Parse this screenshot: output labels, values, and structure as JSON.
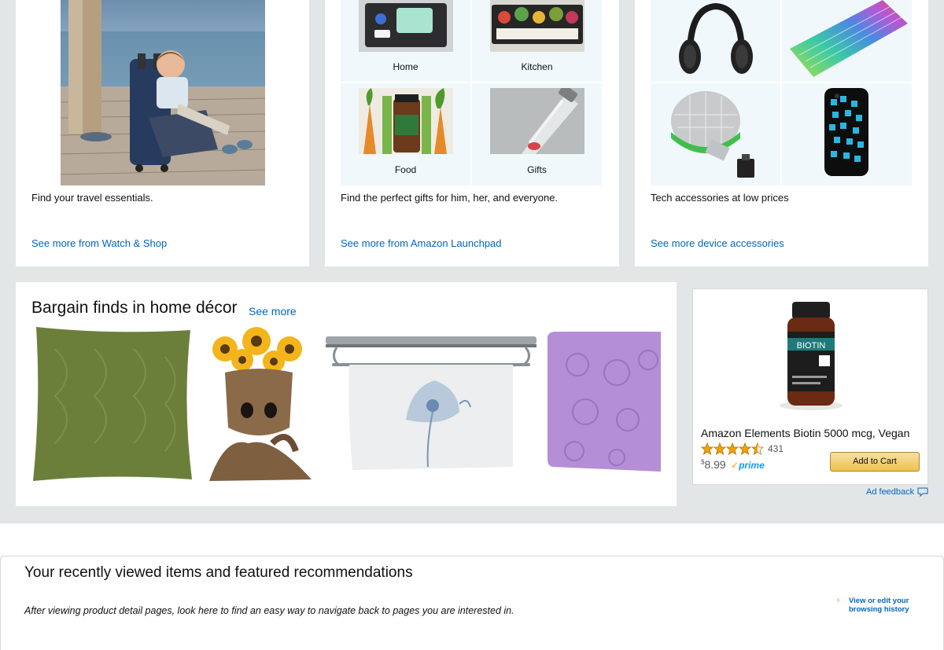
{
  "travel_card": {
    "description": "Find your travel essentials.",
    "link": "See more from Watch & Shop"
  },
  "launchpad_card": {
    "cells": [
      {
        "label": "Home"
      },
      {
        "label": "Kitchen"
      },
      {
        "label": "Food"
      },
      {
        "label": "Gifts"
      }
    ],
    "description": "Find the perfect gifts for him, her, and everyone.",
    "link": "See more from Amazon Launchpad"
  },
  "tech_card": {
    "description": "Tech accessories at low prices",
    "link": "See more device accessories"
  },
  "bargain_card": {
    "title": "Bargain finds in home décor",
    "see_more": "See more"
  },
  "ad": {
    "label_text": "BIOTIN",
    "title": "Amazon Elements Biotin 5000 mcg, Vegan",
    "rating": 4.5,
    "rating_count": "431",
    "price_symbol": "$",
    "price": "8.99",
    "prime_label": "prime",
    "cart_button": "Add to Cart",
    "feedback": "Ad feedback",
    "star_color": "#f0a010"
  },
  "recent": {
    "title": "Your recently viewed items and featured recommendations",
    "description": "After viewing product detail pages, look here to find an easy way to navigate back to pages you are interested in.",
    "link": "View or edit your browsing history"
  },
  "colors": {
    "link": "#0066c0",
    "page_bg": "#e3e6e6",
    "cell_bg": "#f0f8fb",
    "prime_blue": "#1399ff"
  }
}
